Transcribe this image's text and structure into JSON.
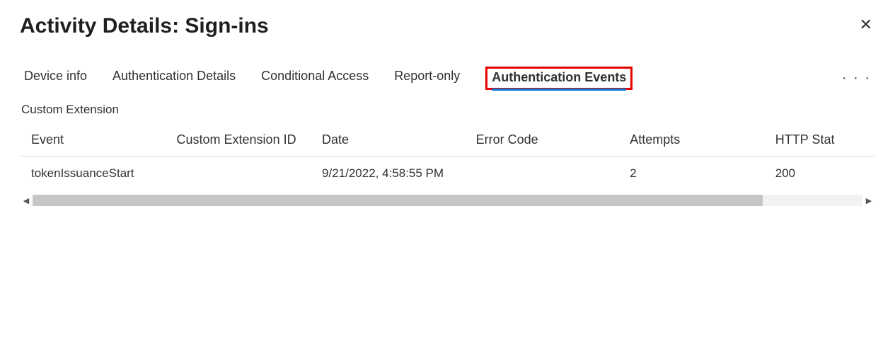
{
  "header": {
    "title": "Activity Details: Sign-ins"
  },
  "tabs": {
    "items": [
      {
        "label": "Device info"
      },
      {
        "label": "Authentication Details"
      },
      {
        "label": "Conditional Access"
      },
      {
        "label": "Report-only"
      },
      {
        "label": "Authentication Events"
      }
    ],
    "active_index": 4
  },
  "panel": {
    "subheading": "Custom Extension",
    "columns": {
      "event": "Event",
      "custom_extension_id": "Custom Extension ID",
      "date": "Date",
      "error_code": "Error Code",
      "attempts": "Attempts",
      "http_stat": "HTTP Stat"
    },
    "rows": [
      {
        "event": "tokenIssuanceStart",
        "custom_extension_id": "",
        "date": "9/21/2022, 4:58:55 PM",
        "error_code": "",
        "attempts": "2",
        "http_stat": "200"
      }
    ]
  }
}
